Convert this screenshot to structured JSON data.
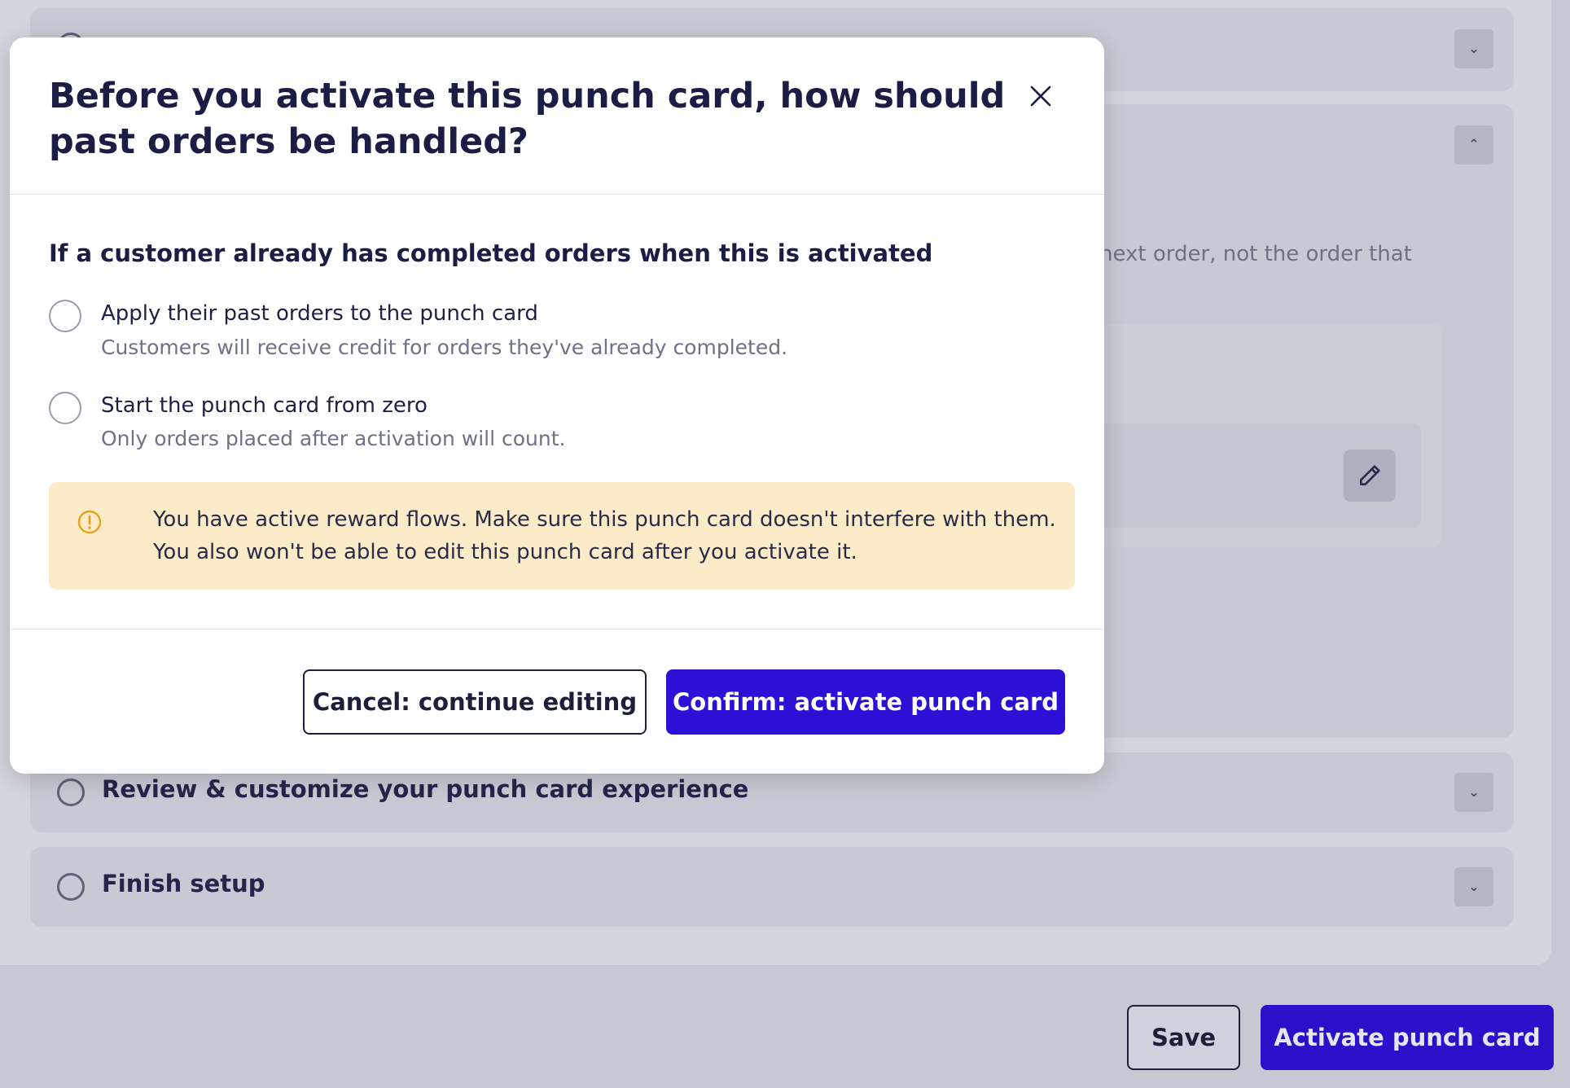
{
  "background": {
    "steps": [
      {
        "title": "Review & customize your punch card experience",
        "chevron": "chevron-down-icon"
      },
      {
        "title": "Finish setup",
        "chevron": "chevron-down-icon"
      }
    ],
    "partial_text": "next order, not the order that",
    "save_label": "Save",
    "activate_label": "Activate punch card"
  },
  "modal": {
    "title": "Before you activate this punch card, how should past orders be handled?",
    "question": "If a customer already has completed orders when this is activated",
    "options": [
      {
        "label": "Apply their past orders to the punch card",
        "description": "Customers will receive credit for orders they've already completed."
      },
      {
        "label": "Start the punch card from zero",
        "description": "Only orders placed after activation will count."
      }
    ],
    "warning": "You have active reward flows. Make sure this punch card doesn't interfere with them. You also won't be able to edit this punch card after you activate it.",
    "cancel_label": "Cancel: continue editing",
    "confirm_label": "Confirm: activate punch card"
  },
  "colors": {
    "accent": "#2b10d6",
    "warning_bg": "#fcebc9",
    "warning_icon": "#e7a21a",
    "overlay": "#c7c8d3"
  }
}
